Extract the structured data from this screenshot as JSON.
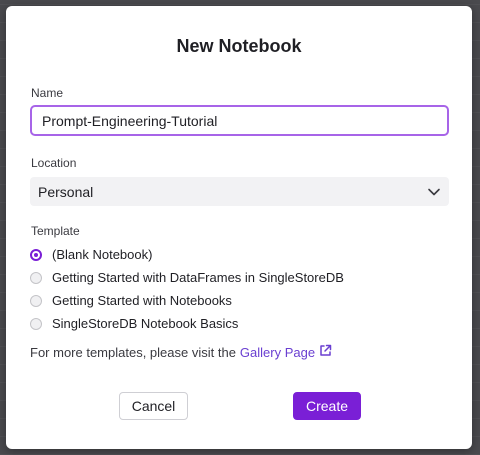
{
  "dialog": {
    "title": "New Notebook",
    "name_label": "Name",
    "name_value": "Prompt-Engineering-Tutorial",
    "location_label": "Location",
    "location_value": "Personal",
    "template_label": "Template",
    "templates": [
      {
        "label": "(Blank Notebook)",
        "selected": true
      },
      {
        "label": "Getting Started with DataFrames in SingleStoreDB",
        "selected": false
      },
      {
        "label": "Getting Started with Notebooks",
        "selected": false
      },
      {
        "label": "SingleStoreDB Notebook Basics",
        "selected": false
      }
    ],
    "more_text": "For more templates, please visit the",
    "gallery_link": "Gallery Page",
    "cancel_label": "Cancel",
    "create_label": "Create"
  },
  "colors": {
    "accent": "#7a1fd6",
    "focus_border": "#a764e8",
    "link": "#6a3fd1"
  },
  "icons": {
    "dropdown": "chevron-down-icon",
    "external": "external-link-icon"
  }
}
